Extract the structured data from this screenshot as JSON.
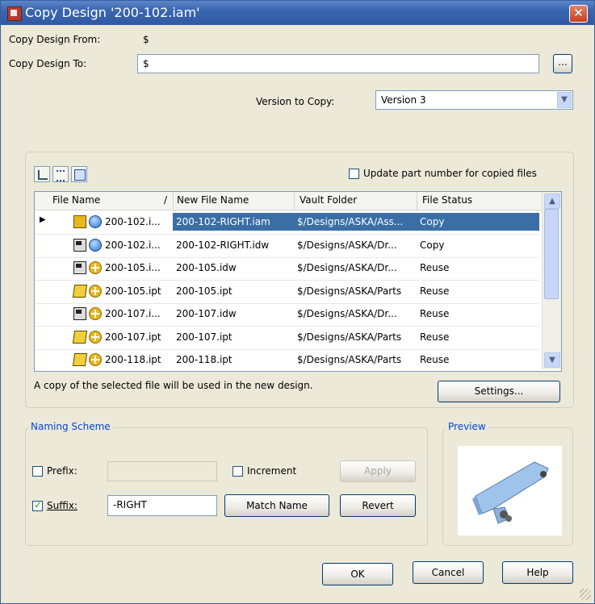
{
  "window": {
    "title": "Copy Design '200-102.iam'"
  },
  "form": {
    "from_label": "Copy Design From:",
    "from_value": "$",
    "to_label": "Copy Design To:",
    "to_value": "$",
    "browse_label": "...",
    "version_label": "Version to Copy:",
    "version_value": "Version 3"
  },
  "files": {
    "update_label": "Update part number for copied files",
    "columns": [
      "File Name",
      "/",
      "New File Name",
      "Vault Folder",
      "File Status"
    ],
    "rows": [
      {
        "name": "200-102.i...",
        "new": "200-102-RIGHT.iam",
        "vault": "$/Designs/ASKA/Ass...",
        "status": "Copy",
        "type": "assembly",
        "action": "copy"
      },
      {
        "name": "200-102.i...",
        "new": "200-102-RIGHT.idw",
        "vault": "$/Designs/ASKA/Dr...",
        "status": "Copy",
        "type": "drawing",
        "action": "copy"
      },
      {
        "name": "200-105.i...",
        "new": "200-105.idw",
        "vault": "$/Designs/ASKA/Dr...",
        "status": "Reuse",
        "type": "drawing",
        "action": "reuse"
      },
      {
        "name": "200-105.ipt",
        "new": "200-105.ipt",
        "vault": "$/Designs/ASKA/Parts",
        "status": "Reuse",
        "type": "part",
        "action": "reuse"
      },
      {
        "name": "200-107.i...",
        "new": "200-107.idw",
        "vault": "$/Designs/ASKA/Dr...",
        "status": "Reuse",
        "type": "drawing",
        "action": "reuse"
      },
      {
        "name": "200-107.ipt",
        "new": "200-107.ipt",
        "vault": "$/Designs/ASKA/Parts",
        "status": "Reuse",
        "type": "part",
        "action": "reuse"
      },
      {
        "name": "200-118.ipt",
        "new": "200-118.ipt",
        "vault": "$/Designs/ASKA/Parts",
        "status": "Reuse",
        "type": "part",
        "action": "reuse"
      }
    ],
    "hint": "A copy of the selected file will be used in the new design.",
    "settings_label": "Settings..."
  },
  "naming": {
    "group_label": "Naming Scheme",
    "prefix_label": "Prefix:",
    "prefix_value": "",
    "increment_label": "Increment",
    "apply_label": "Apply",
    "suffix_label": "Suffix:",
    "suffix_value": "-RIGHT",
    "match_label": "Match Name",
    "revert_label": "Revert"
  },
  "preview": {
    "label": "Preview"
  },
  "footer": {
    "ok": "OK",
    "cancel": "Cancel",
    "help": "Help"
  },
  "colors": {
    "title_bar": "#3a66b0",
    "selection": "#3a6ea5",
    "group_label": "#0046d5"
  }
}
